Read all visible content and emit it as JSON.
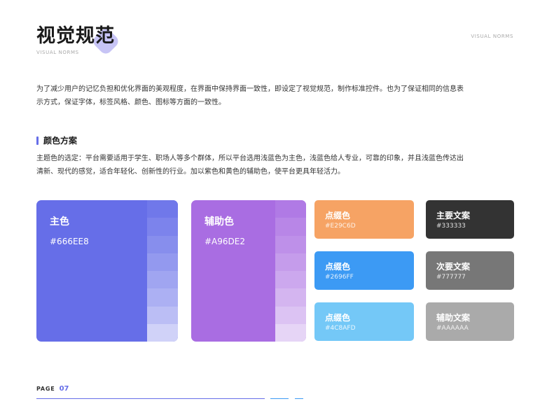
{
  "header": {
    "title": "视觉规范",
    "subtitle": "VISUAL NORMS",
    "corner_label": "VISUAL NORMS"
  },
  "intro": "为了减少用户的记忆负担和优化界面的美观程度，在界面中保持界面一致性，即设定了视觉规范，制作标准控件。也为了保证相同的信息表示方式，保证字体，标签风格、颜色、图标等方面的一致性。",
  "section": {
    "title": "颜色方案",
    "description": "主题色的选定：平台需要适用于学生、职场人等多个群体，所以平台选用浅蓝色为主色，浅蓝色给人专业，可靠的印象，并且浅蓝色传达出清新、现代的感觉，适合年轻化、创新性的行业。加以紫色和黄色的辅助色，使平台更具年轻活力。"
  },
  "colors": {
    "primary": {
      "name": "主色",
      "hex": "#666EE8",
      "shades": [
        "#7078EA",
        "#7C83EC",
        "#878EED",
        "#9399EF",
        "#A0A5F1",
        "#ACB0F3",
        "#BBBEF5",
        "#D0D2F8"
      ]
    },
    "secondary": {
      "name": "辅助色",
      "hex": "#A96DE2",
      "shades": [
        "#B07AE5",
        "#B886E7",
        "#BE90E9",
        "#C59CEB",
        "#CCA8EE",
        "#D4B5F0",
        "#DCC3F3",
        "#E6D5F6"
      ]
    },
    "accents": [
      {
        "name": "点缀色",
        "hex": "#E29C6D",
        "fill": "#F6A364"
      },
      {
        "name": "点缀色",
        "hex": "#2696FF",
        "fill": "#3C9AF4"
      },
      {
        "name": "点缀色",
        "hex": "#4C8AFD",
        "fill": "#74C8F7"
      }
    ],
    "text": [
      {
        "name": "主要文案",
        "hex": "#333333"
      },
      {
        "name": "次要文案",
        "hex": "#777777"
      },
      {
        "name": "辅助文案",
        "hex": "#AAAAAA"
      }
    ]
  },
  "footer": {
    "page_label": "PAGE",
    "page_number": "07"
  }
}
